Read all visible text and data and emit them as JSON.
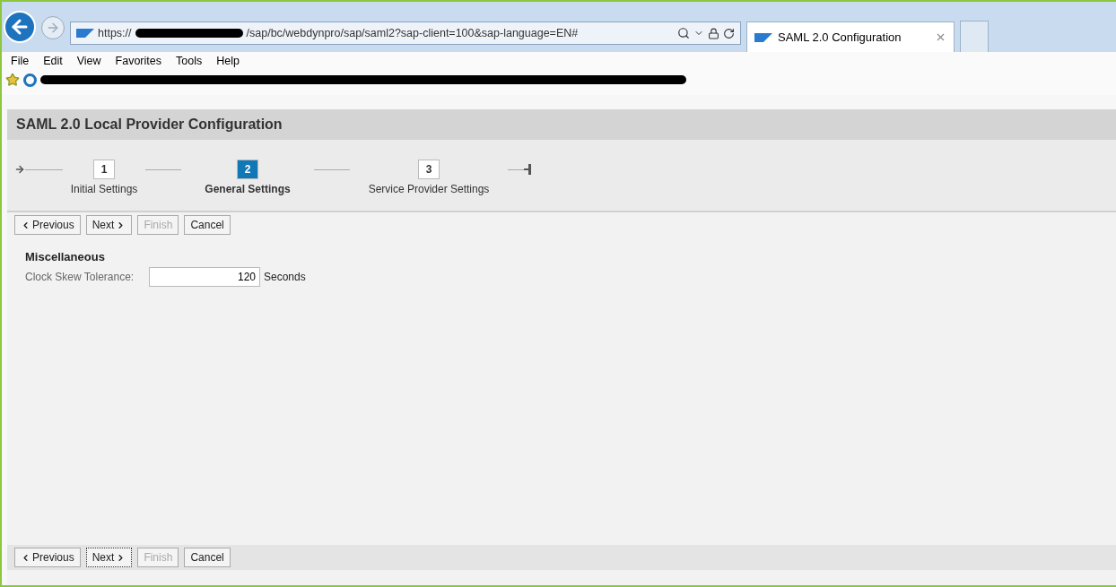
{
  "browser": {
    "url_prefix": "https://",
    "url_path": "/sap/bc/webdynpro/sap/saml2?sap-client=100&sap-language=EN#",
    "tabs": [
      {
        "label": "SAML 2.0 Configuration",
        "selected": true
      }
    ],
    "menu": [
      "File",
      "Edit",
      "View",
      "Favorites",
      "Tools",
      "Help"
    ]
  },
  "page": {
    "title": "SAML 2.0 Local Provider Configuration",
    "steps": [
      {
        "number": "1",
        "label": "Initial Settings",
        "selected": false
      },
      {
        "number": "2",
        "label": "General Settings",
        "selected": true
      },
      {
        "number": "3",
        "label": "Service Provider Settings",
        "selected": false
      }
    ],
    "top_buttons": [
      {
        "label": "Previous",
        "kind": "prev",
        "disabled": false,
        "focused": false
      },
      {
        "label": "Next",
        "kind": "next",
        "disabled": false,
        "focused": false
      },
      {
        "label": "Finish",
        "kind": "plain",
        "disabled": true,
        "focused": false
      },
      {
        "label": "Cancel",
        "kind": "plain",
        "disabled": false,
        "focused": false
      }
    ],
    "section_title": "Miscellaneous",
    "field": {
      "label": "Clock Skew Tolerance:",
      "value": "120",
      "unit": "Seconds"
    },
    "bottom_buttons": [
      {
        "label": "Previous",
        "kind": "prev",
        "disabled": false,
        "focused": false
      },
      {
        "label": "Next",
        "kind": "next",
        "disabled": false,
        "focused": true
      },
      {
        "label": "Finish",
        "kind": "plain",
        "disabled": true,
        "focused": false
      },
      {
        "label": "Cancel",
        "kind": "plain",
        "disabled": false,
        "focused": false
      }
    ]
  }
}
